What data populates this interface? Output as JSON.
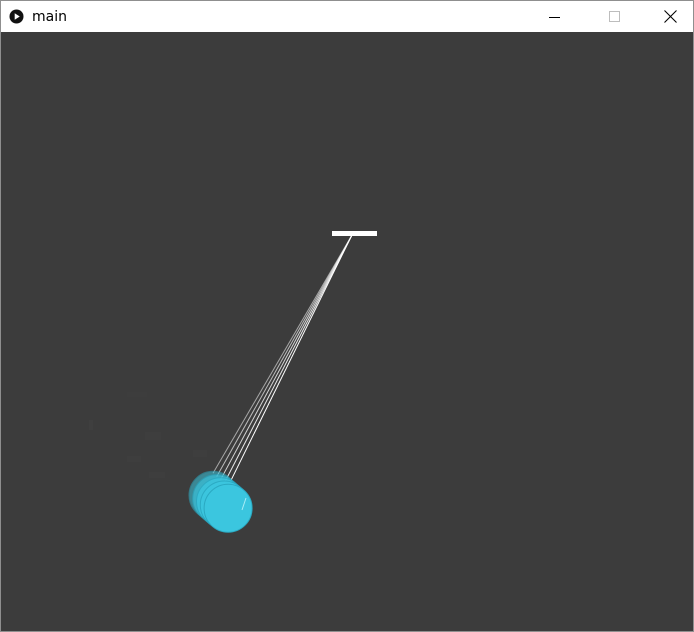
{
  "window": {
    "title": "main",
    "icons": {
      "app": "processing-play-icon",
      "minimize": "minimize-icon",
      "maximize": "maximize-icon",
      "close": "close-icon"
    }
  },
  "canvas": {
    "background_color": "#3c3c3c",
    "pivot_color": "#ffffff",
    "rod_color": "#ffffff",
    "bob_color": "#3bc6df",
    "bob_edge_color": "#2aa9c2",
    "bob_trail_count": 5
  }
}
